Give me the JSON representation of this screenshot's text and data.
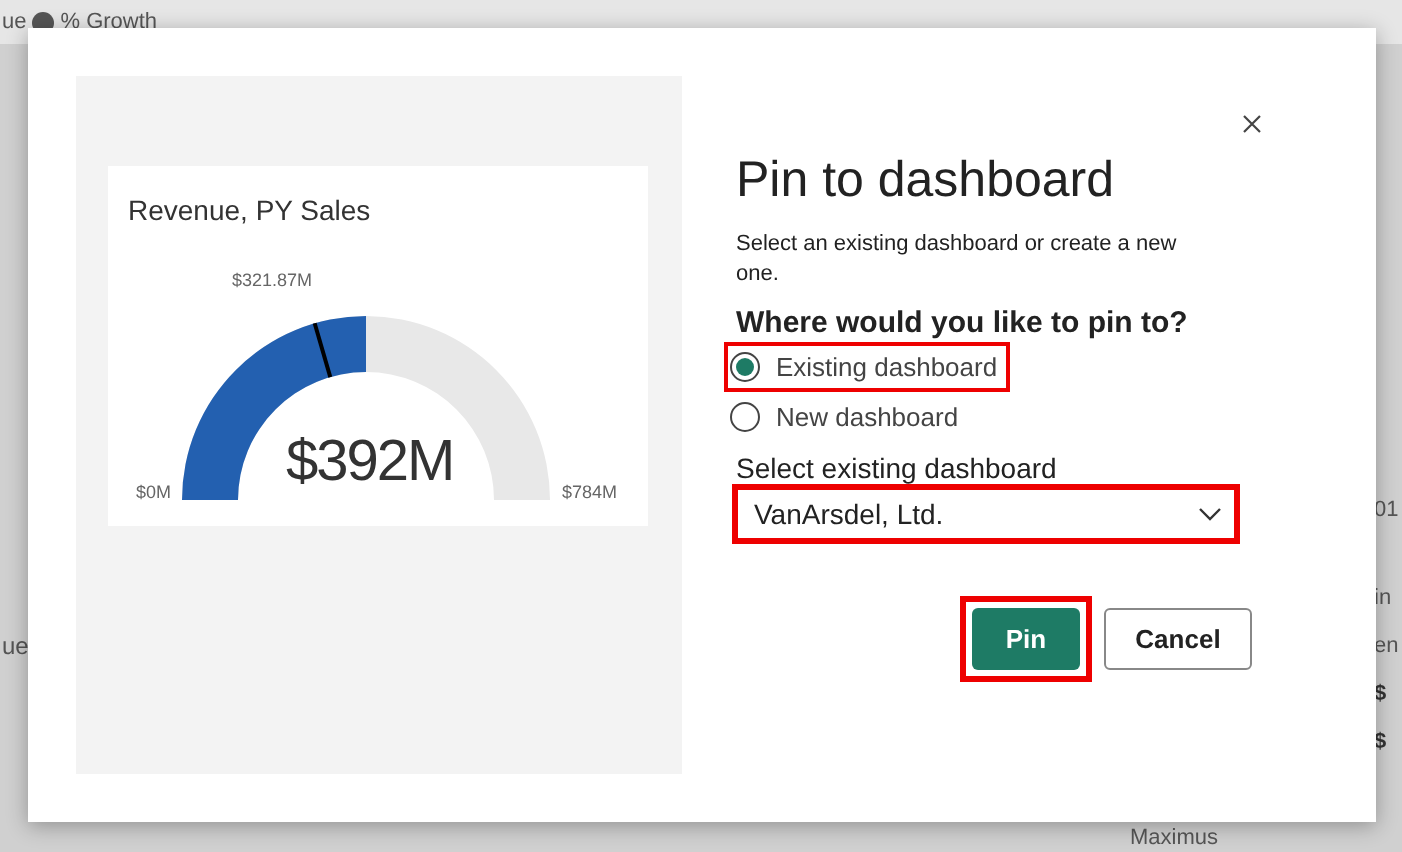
{
  "background": {
    "top_texts": [
      "ue",
      "% Growth"
    ],
    "left_texts": [
      "ue"
    ],
    "right_texts": [
      "01",
      "in",
      "en",
      "$",
      "$"
    ],
    "bottom_text": "Maximus"
  },
  "preview": {
    "title": "Revenue, PY Sales",
    "value": "$392M",
    "level": 0.5,
    "target_label": "$321.87M",
    "min_label": "$0M",
    "max_label": "$784M"
  },
  "dialog": {
    "title": "Pin to dashboard",
    "description": "Select an existing dashboard or create a new one.",
    "question": "Where would you like to pin to?",
    "options": [
      {
        "label": "Existing dashboard",
        "selected": true,
        "highlighted": true
      },
      {
        "label": "New dashboard",
        "selected": false,
        "highlighted": false
      }
    ],
    "dropdown": {
      "label": "Select existing dashboard",
      "value": "VanArsdel, Ltd.",
      "highlighted": true
    },
    "buttons": [
      {
        "label": "Pin",
        "kind": "primary",
        "highlighted": true
      },
      {
        "label": "Cancel",
        "kind": "secondary",
        "highlighted": false
      }
    ]
  }
}
